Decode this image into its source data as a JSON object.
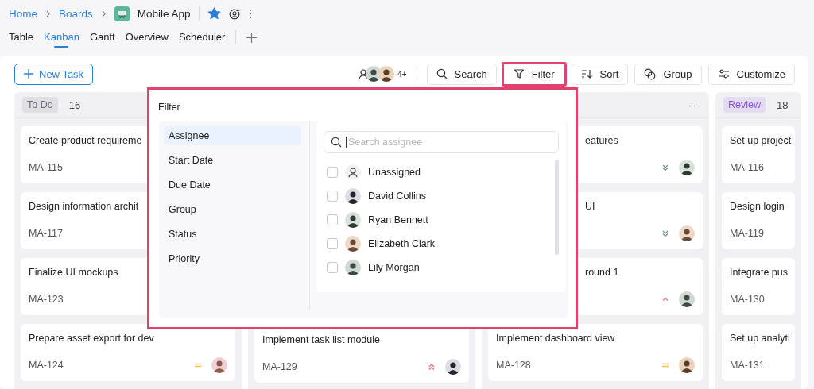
{
  "breadcrumb": {
    "items": [
      "Home",
      "Boards"
    ],
    "current": "Mobile App",
    "starred": true
  },
  "tabs": [
    {
      "label": "Table",
      "selected": false
    },
    {
      "label": "Kanban",
      "selected": true
    },
    {
      "label": "Gantt",
      "selected": false
    },
    {
      "label": "Overview",
      "selected": false
    },
    {
      "label": "Scheduler",
      "selected": false
    }
  ],
  "toolbar": {
    "new_task": "New Task",
    "avatar_count": "4+",
    "buttons": [
      {
        "kind": "search",
        "label": "Search",
        "highlighted": false
      },
      {
        "kind": "filter",
        "label": "Filter",
        "highlighted": true
      },
      {
        "kind": "sort",
        "label": "Sort",
        "highlighted": false
      },
      {
        "kind": "group",
        "label": "Group",
        "highlighted": false
      },
      {
        "kind": "customize",
        "label": "Customize",
        "highlighted": false
      }
    ]
  },
  "columns": [
    {
      "status": "To Do",
      "count": "16",
      "color": "#6b6b70",
      "cards": [
        {
          "title": "Create product requireme",
          "id": "MA-115"
        },
        {
          "title": "Design information archit",
          "id": "MA-117"
        },
        {
          "title": "Finalize UI mockups",
          "id": "MA-123"
        },
        {
          "title": "Prepare asset export for dev",
          "id": "MA-124",
          "priority": {
            "kind": "medium"
          },
          "avatar": true
        }
      ]
    },
    {
      "covered": true,
      "cards": [
        {
          "title": "Implement task list module",
          "id": "MA-129",
          "priority": {
            "kind": "highest"
          },
          "avatar": true
        }
      ]
    },
    {
      "menu": "···",
      "cards": [
        {
          "title": "eatures",
          "partly_covered": true,
          "priority": {
            "kind": "lowest"
          },
          "avatar": true
        },
        {
          "title": "UI",
          "partly_covered": true,
          "priority": {
            "kind": "lowest"
          },
          "avatar": true
        },
        {
          "title": "round 1",
          "partly_covered": true,
          "priority": {
            "kind": "high"
          },
          "avatar": true
        },
        {
          "title": "Implement dashboard view",
          "id": "MA-128",
          "priority": {
            "kind": "medium"
          },
          "avatar": true
        }
      ]
    },
    {
      "status": "Review",
      "count": "18",
      "color": "#8a55e0",
      "cards": [
        {
          "title": "Set up project",
          "id": "MA-116"
        },
        {
          "title": "Design login",
          "id": "MA-119"
        },
        {
          "title": "Integrate pus",
          "id": "MA-130"
        },
        {
          "title": "Set up analyti",
          "id": "MA-131"
        }
      ]
    }
  ],
  "filter_popover": {
    "title": "Filter",
    "fields": [
      {
        "label": "Assignee",
        "selected": true
      },
      {
        "label": "Start Date",
        "selected": false
      },
      {
        "label": "Due Date",
        "selected": false
      },
      {
        "label": "Group",
        "selected": false
      },
      {
        "label": "Status",
        "selected": false
      },
      {
        "label": "Priority",
        "selected": false
      }
    ],
    "search": {
      "placeholder": "Search assignee"
    },
    "options": [
      {
        "name": "Unassigned",
        "kind": "unassigned",
        "checked": false
      },
      {
        "name": "David Collins",
        "kind": "person",
        "checked": false
      },
      {
        "name": "Ryan Bennett",
        "kind": "person",
        "checked": false
      },
      {
        "name": "Elizabeth Clark",
        "kind": "person",
        "checked": false
      },
      {
        "name": "Lily Morgan",
        "kind": "person",
        "checked": false
      }
    ]
  }
}
